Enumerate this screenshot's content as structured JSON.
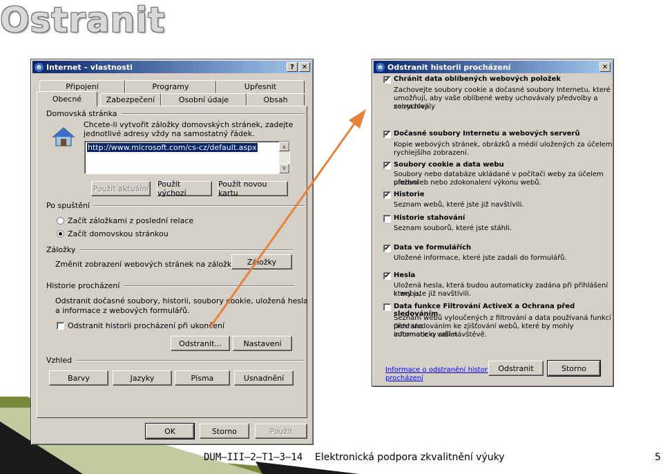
{
  "slide": {
    "title": "Ostranit",
    "footer_left": "DUM–III–2–T1–3–14",
    "footer_center": "Elektronická podpora zkvalitnění výuky",
    "page_number": "5"
  },
  "left_dialog": {
    "title": "Internet – vlastnosti",
    "help_btn": "?",
    "close_btn": "✕",
    "tabs_row1": [
      "Připojení",
      "Programy",
      "Upřesnit"
    ],
    "tabs_row2": [
      "Obecné",
      "Zabezpečení",
      "Osobní údaje",
      "Obsah"
    ],
    "homepage": {
      "group_label": "Domovská stránka",
      "desc_line1": "Chcete-li vytvořit záložky domovských stránek, zadejte",
      "desc_line2": "jednotlivé adresy vždy na samostatný řádek.",
      "url": "http://www.microsoft.com/cs-cz/default.aspx",
      "btn_current": "Použít aktuální",
      "btn_default": "Použít výchozí",
      "btn_new_tab": "Použít novou kartu"
    },
    "startup": {
      "group_label": "Po spuštění",
      "option1": "Začít záložkami z poslední relace",
      "option2": "Začít domovskou stránkou"
    },
    "tabs_section": {
      "group_label": "Záložky",
      "desc": "Změnit zobrazení webových stránek na záložkách.",
      "btn": "Záložky"
    },
    "history": {
      "group_label": "Historie procházení",
      "desc_line1": "Odstranit dočasné soubory, historii, soubory cookie, uložená hesla",
      "desc_line2": "a informace z webových formulářů.",
      "checkbox_label": "Odstranit historii procházení při ukončení",
      "btn_delete": "Odstranit...",
      "btn_settings": "Nastavení"
    },
    "appearance": {
      "group_label": "Vzhled",
      "btn_colors": "Barvy",
      "btn_languages": "Jazyky",
      "btn_fonts": "Písma",
      "btn_accessibility": "Usnadnění"
    },
    "btn_ok": "OK",
    "btn_cancel": "Storno",
    "btn_apply": "Použít"
  },
  "right_dialog": {
    "title": "Odstranit historii procházení",
    "close_btn": "✕",
    "items": [
      {
        "title": "Chránit data oblíbených webových položek",
        "checked": true,
        "desc": [
          "Zachovejte soubory cookie a dočasné soubory Internetu, které",
          "umožňují, aby vaše oblíbené weby uchovávaly předvolby a zobrazovaly",
          "se rychleji."
        ]
      },
      {
        "title": "Dočasné soubory Internetu a webových serverů",
        "checked": true,
        "desc": [
          "Kopie webových stránek, obrázků a médií uložených za účelem",
          "rychlejšího zobrazení."
        ]
      },
      {
        "title": "Soubory cookie a data webu",
        "checked": true,
        "desc": [
          "Soubory nebo databáze ukládané v počítači weby za účelem uložení",
          "předvoleb nebo zdokonalení výkonu webů."
        ]
      },
      {
        "title": "Historie",
        "checked": true,
        "desc": [
          "Seznam webů, které jste již navštívili."
        ]
      },
      {
        "title": "Historie stahování",
        "checked": false,
        "desc": [
          "Seznam souborů, které jste stáhli."
        ]
      },
      {
        "title": "Data ve formulářích",
        "checked": true,
        "desc": [
          "Uložené informace, které jste zadali do formulářů."
        ]
      },
      {
        "title": "Hesla",
        "checked": true,
        "desc": [
          "Uložená hesla, která budou automaticky zadána při přihlášení k webu,",
          "který jste již navštívili."
        ]
      },
      {
        "title": "Data funkce Filtrování ActiveX a Ochrana před sledováním",
        "checked": false,
        "desc": [
          "Seznam webů vyloučených z filtrování a data používaná funkcí Ochrana",
          "před sledováním ke zjišťování webů, které by mohly automaticky sdílet",
          "informace o vaší návštěvě."
        ]
      }
    ],
    "link_line1": "Informace o odstranění historie",
    "link_line2": "procházení",
    "btn_delete": "Odstranit",
    "btn_cancel": "Storno"
  },
  "colors": {
    "arrow": "#e8823a",
    "titlebar": "#0a246a",
    "link": "#0000ff"
  }
}
